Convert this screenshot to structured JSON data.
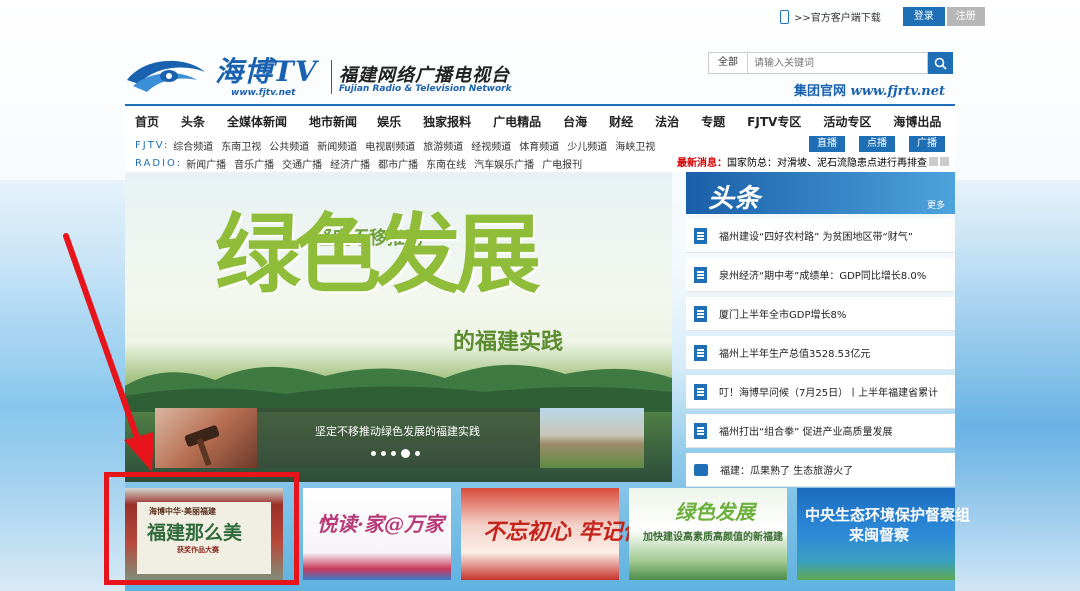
{
  "topbar": {
    "client_download": ">>官方客户端下载",
    "login": "登录",
    "register": "注册"
  },
  "logo": {
    "brand": "海博TV",
    "url": "www.fjtv.net",
    "station_cn": "福建网络广播电视台",
    "station_en": "Fujian Radio & Television Network"
  },
  "search": {
    "scope": "全部",
    "placeholder": "请输入关键词"
  },
  "group_site": {
    "label": "集团官网",
    "url": "www.fjrtv.net"
  },
  "main_menu": [
    "首页",
    "头条",
    "全媒体新闻",
    "地市新闻",
    "娱乐",
    "独家报料",
    "广电精品",
    "台海",
    "财经",
    "法治",
    "专题",
    "FJTV专区",
    "活动专区",
    "海博出品"
  ],
  "fjtv_row": {
    "label": "FJTV:",
    "items": [
      "综合频道",
      "东南卫视",
      "公共频道",
      "新闻频道",
      "电视剧频道",
      "旅游频道",
      "经视频道",
      "体育频道",
      "少儿频道",
      "海峡卫视"
    ]
  },
  "radio_row": {
    "label": "RADIO:",
    "items": [
      "新闻广播",
      "音乐广播",
      "交通广播",
      "经济广播",
      "都市广播",
      "东南在线",
      "汽车娱乐广播",
      "广电报刊"
    ]
  },
  "pills": [
    "直播",
    "点播",
    "广播"
  ],
  "breaking": {
    "label": "最新消息：",
    "text": "国家防总：对滑坡、泥石流隐患点进行再排查"
  },
  "banner": {
    "top_text": "坚定不移推动",
    "big_text": "绿色发展",
    "sub_text": "的福建实践",
    "caption": "坚定不移推动绿色发展的福建实践",
    "slides_total": 5,
    "active_slide": 4
  },
  "headlines": {
    "title": "头条",
    "more": "更多",
    "items": [
      {
        "text": "福州建设“四好农村路” 为贫困地区带“财气”",
        "icon": "document-icon"
      },
      {
        "text": "泉州经济“期中考”成绩单：GDP同比增长8.0%",
        "icon": "document-icon"
      },
      {
        "text": "厦门上半年全市GDP增长8%",
        "icon": "document-icon"
      },
      {
        "text": "福州上半年生产总值3528.53亿元",
        "icon": "document-icon"
      },
      {
        "text": "叮！海博早问候（7月25日）丨上半年福建省累计",
        "icon": "document-icon"
      },
      {
        "text": "福州打出“组合拳” 促进产业高质量发展",
        "icon": "document-icon"
      },
      {
        "text": "福建：瓜果熟了 生态旅游火了",
        "icon": "video-icon"
      }
    ]
  },
  "tiles": {
    "t1_small": "海博中华·美丽福建",
    "t1_main": "福建那么美",
    "t1_bottom": "获奖作品大赛",
    "t2_main": "悦读·家@万家",
    "t3_main": "不忘初心 牢记使命",
    "t4_main": "绿色发展",
    "t4_sub": "加快建设高素质高颜值的新福建",
    "t5_line1": "中央生态环境保护督察组",
    "t5_line2": "来闽督察"
  },
  "colors": {
    "brand_blue": "#1e6fb6",
    "annotation_red": "#e8141b"
  }
}
